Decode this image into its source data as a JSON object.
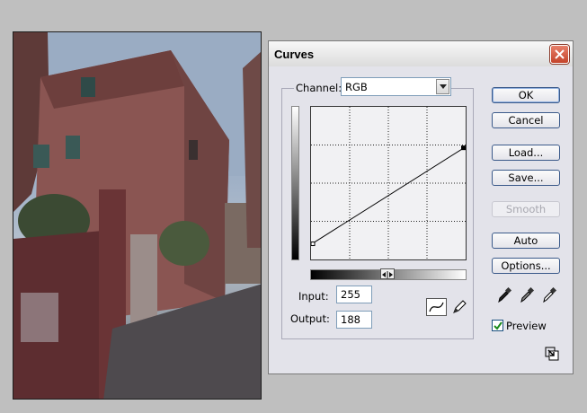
{
  "dialog": {
    "title": "Curves",
    "channel_label": "Channel:",
    "channel_value": "RGB",
    "input_label": "Input:",
    "input_value": "255",
    "output_label": "Output:",
    "output_value": "188",
    "preview_label": "Preview",
    "preview_checked": true
  },
  "buttons": {
    "ok": "OK",
    "cancel": "Cancel",
    "load": "Load...",
    "save": "Save...",
    "smooth": "Smooth",
    "auto": "Auto",
    "options": "Options..."
  },
  "curve": {
    "points": [
      [
        0,
        25
      ],
      [
        255,
        188
      ]
    ],
    "grid_divisions": 4
  },
  "icons": {
    "close": "close-icon",
    "dropdown": "chevron-down-icon",
    "curve_tool": "curve-tool-icon",
    "pencil_tool": "pencil-icon",
    "black_point": "black-eyedropper-icon",
    "gray_point": "gray-eyedropper-icon",
    "white_point": "white-eyedropper-icon",
    "resize": "resize-icon"
  }
}
